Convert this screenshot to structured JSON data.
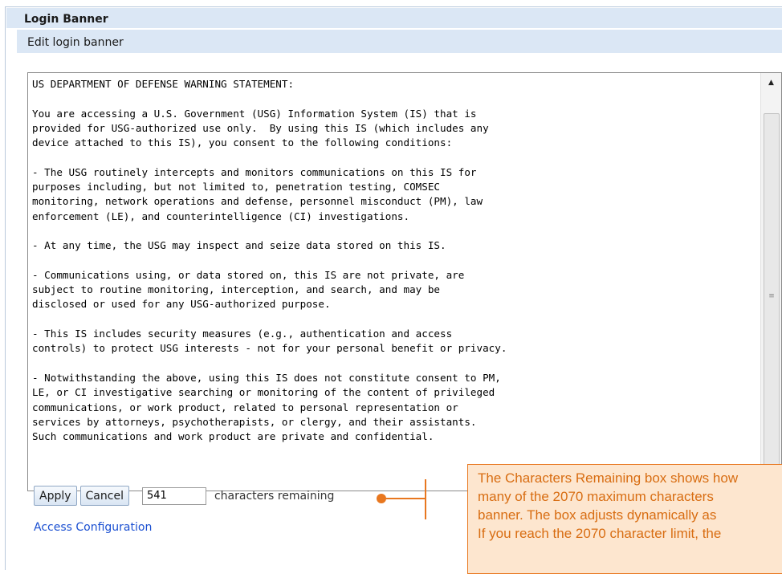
{
  "section": {
    "title": "Login Banner",
    "subtitle": "Edit login banner"
  },
  "banner_text": "US DEPARTMENT OF DEFENSE WARNING STATEMENT:\n\nYou are accessing a U.S. Government (USG) Information System (IS) that is\nprovided for USG-authorized use only.  By using this IS (which includes any\ndevice attached to this IS), you consent to the following conditions:\n\n- The USG routinely intercepts and monitors communications on this IS for\npurposes including, but not limited to, penetration testing, COMSEC\nmonitoring, network operations and defense, personnel misconduct (PM), law\nenforcement (LE), and counterintelligence (CI) investigations.\n\n- At any time, the USG may inspect and seize data stored on this IS.\n\n- Communications using, or data stored on, this IS are not private, are\nsubject to routine monitoring, interception, and search, and may be\ndisclosed or used for any USG-authorized purpose.\n\n- This IS includes security measures (e.g., authentication and access\ncontrols) to protect USG interests - not for your personal benefit or privacy.\n\n- Notwithstanding the above, using this IS does not constitute consent to PM,\nLE, or CI investigative searching or monitoring of the content of privileged\ncommunications, or work product, related to personal representation or\nservices by attorneys, psychotherapists, or clergy, and their assistants.\nSuch communications and work product are private and confidential.",
  "controls": {
    "apply_label": "Apply",
    "cancel_label": "Cancel",
    "characters_remaining_value": "541",
    "characters_remaining_label": "characters remaining"
  },
  "links": {
    "access_configuration": "Access Configuration"
  },
  "callout": {
    "text": "The Characters Remaining box shows how\nmany of the 2070 maximum characters\nbanner. The box adjusts dynamically as\nIf you reach the 2070 character limit, the"
  },
  "icons": {
    "scroll_up": "triangle-up-icon",
    "scroll_grip": "grip-icon"
  },
  "colors": {
    "header_bg": "#dbe7f5",
    "link": "#1a4fd1",
    "callout_accent": "#e8771f",
    "callout_bg": "#fde6cf"
  }
}
